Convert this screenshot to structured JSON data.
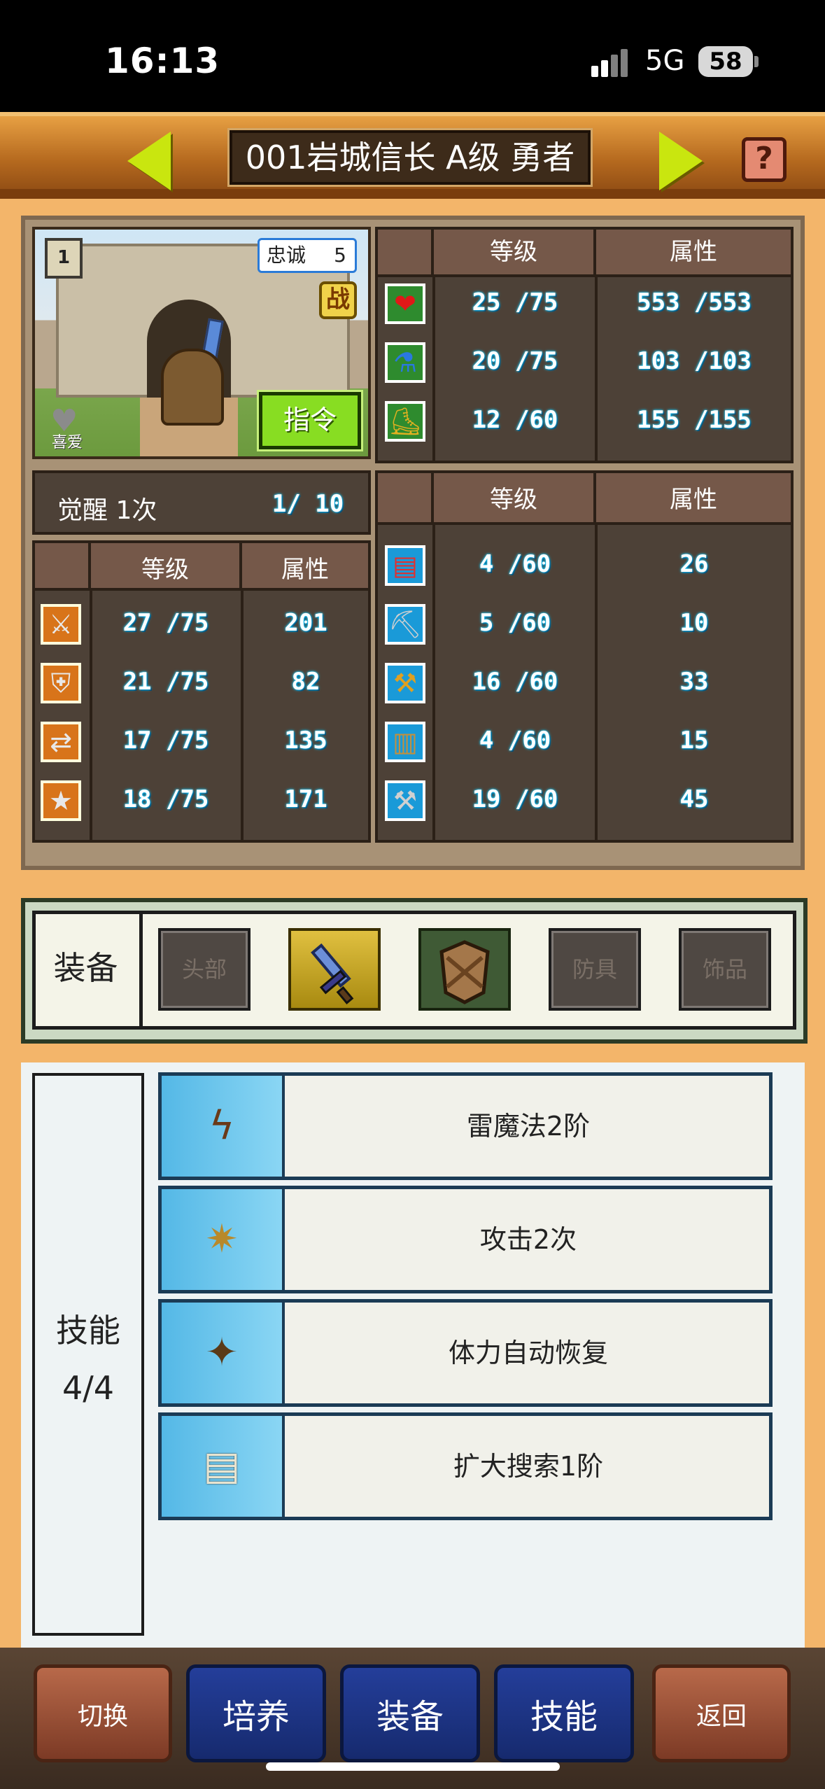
{
  "status_bar": {
    "time": "16:13",
    "network": "5G",
    "battery": "58"
  },
  "header": {
    "title": "001岩城信长 A级 勇者",
    "help": "?"
  },
  "portrait": {
    "loyalty_label": "忠诚",
    "loyalty_value": "5",
    "book_level": "1",
    "battle_badge": "战",
    "command_button": "指令",
    "like_label": "喜爱"
  },
  "vitals": {
    "level_header": "等级",
    "attr_header": "属性",
    "rows": [
      {
        "icon": "heart-icon",
        "level": "25 /75",
        "attr": "553 /553"
      },
      {
        "icon": "potion-icon",
        "level": "20 /75",
        "attr": "103 /103"
      },
      {
        "icon": "boot-icon",
        "level": "12 /60",
        "attr": "155 /155"
      }
    ]
  },
  "awaken": {
    "label": "觉醒 1次",
    "value": "1/ 10"
  },
  "combat_stats": {
    "level_header": "等级",
    "attr_header": "属性",
    "rows": [
      {
        "icon": "attack-icon",
        "level": "27 /75",
        "attr": "201"
      },
      {
        "icon": "defense-icon",
        "level": "21 /75",
        "attr": "82"
      },
      {
        "icon": "agility-icon",
        "level": "17 /75",
        "attr": "135"
      },
      {
        "icon": "luck-icon",
        "level": "18 /75",
        "attr": "171"
      }
    ]
  },
  "work_stats": {
    "level_header": "等级",
    "attr_header": "属性",
    "rows": [
      {
        "icon": "book-skill-icon",
        "level": "4 /60",
        "attr": "26"
      },
      {
        "icon": "pickaxe-icon",
        "level": "5 /60",
        "attr": "10"
      },
      {
        "icon": "shovel-icon",
        "level": "16 /60",
        "attr": "33"
      },
      {
        "icon": "chest-icon",
        "level": "4 /60",
        "attr": "15"
      },
      {
        "icon": "hammer-icon",
        "level": "19 /60",
        "attr": "45"
      }
    ]
  },
  "equipment": {
    "label": "装备",
    "slots": [
      {
        "name": "head",
        "label": "头部"
      },
      {
        "name": "weapon",
        "label": ""
      },
      {
        "name": "shield",
        "label": ""
      },
      {
        "name": "armor",
        "label": "防具"
      },
      {
        "name": "accessory",
        "label": "饰品"
      }
    ]
  },
  "skills": {
    "label": "技能",
    "count": "4/4",
    "items": [
      {
        "icon": "thunder-staff-icon",
        "name": "雷魔法2阶"
      },
      {
        "icon": "double-strike-icon",
        "name": "攻击2次"
      },
      {
        "icon": "healing-staff-icon",
        "name": "体力自动恢复"
      },
      {
        "icon": "scroll-icon",
        "name": "扩大搜索1阶"
      }
    ]
  },
  "bottom_nav": {
    "switch": "切换",
    "train": "培养",
    "equip": "装备",
    "skill": "技能",
    "back": "返回"
  },
  "colors": {
    "accent_green": "#c9e60f",
    "header_brown": "#b66a1f",
    "nav_blue": "#243e9a",
    "nav_brown": "#b8694a"
  }
}
